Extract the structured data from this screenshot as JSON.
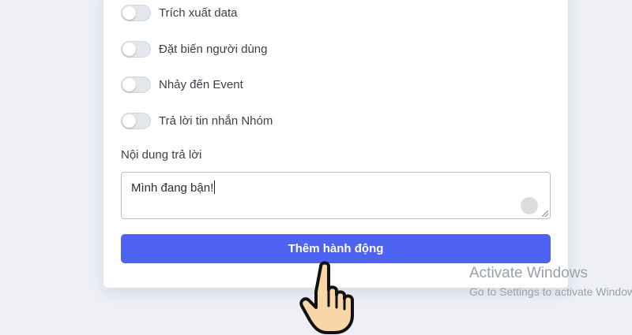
{
  "toggles": [
    {
      "label": "Trích xuất data",
      "on": false
    },
    {
      "label": "Đặt biến người dùng",
      "on": false
    },
    {
      "label": "Nhảy đến Event",
      "on": false
    },
    {
      "label": "Trả lời tin nhắn Nhóm",
      "on": false
    }
  ],
  "reply": {
    "label": "Nội dung trả lời",
    "value": "Mình đang bận!"
  },
  "submit_label": "Thêm hành động",
  "watermark": {
    "line1": "Activate Windows",
    "line2": "Go to Settings to activate Windows."
  },
  "colors": {
    "primary": "#4e63f2",
    "background": "#eef0f6"
  },
  "cursor_icon": "hand-pointer-icon"
}
